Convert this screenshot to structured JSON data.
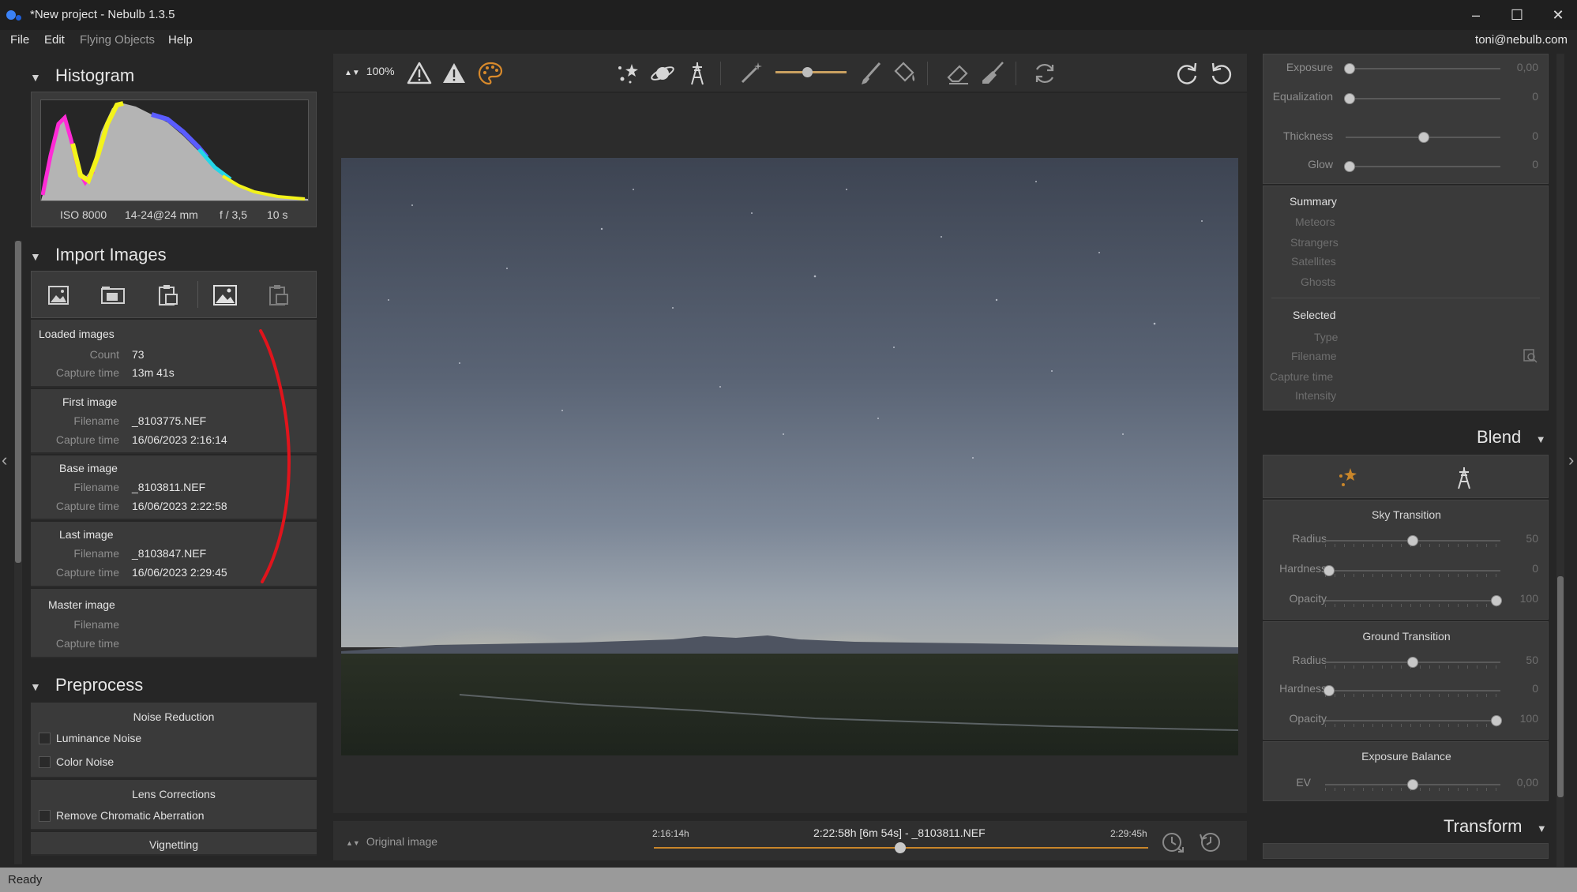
{
  "window": {
    "title": "*New project - Nebulb 1.3.5",
    "controls": [
      "minimize",
      "maximize",
      "close"
    ]
  },
  "menu": {
    "items": [
      "File",
      "Edit",
      "Flying Objects",
      "Help"
    ],
    "user": "toni@nebulb.com"
  },
  "status": "Ready",
  "histogram": {
    "title": "Histogram",
    "iso": "ISO 8000",
    "lens": "14-24@24 mm",
    "aperture": "f / 3,5",
    "exposure": "10 s"
  },
  "import": {
    "title": "Import Images",
    "toolbar_icons": [
      "add-images-icon",
      "add-folder-icon",
      "paste-images-icon",
      "image-icon",
      "clear-images-icon"
    ],
    "loaded": {
      "title": "Loaded images",
      "count_label": "Count",
      "count": "73",
      "capture_label": "Capture time",
      "capture": "13m 41s"
    },
    "first": {
      "title": "First image",
      "filename_label": "Filename",
      "filename": "_8103775.NEF",
      "capture_label": "Capture time",
      "capture": "16/06/2023 2:16:14"
    },
    "base": {
      "title": "Base image",
      "filename_label": "Filename",
      "filename": "_8103811.NEF",
      "capture_label": "Capture time",
      "capture": "16/06/2023 2:22:58"
    },
    "last": {
      "title": "Last image",
      "filename_label": "Filename",
      "filename": "_8103847.NEF",
      "capture_label": "Capture time",
      "capture": "16/06/2023 2:29:45"
    },
    "master": {
      "title": "Master image",
      "filename_label": "Filename",
      "capture_label": "Capture time"
    }
  },
  "preprocess": {
    "title": "Preprocess",
    "noise_title": "Noise Reduction",
    "luminance": "Luminance Noise",
    "color": "Color Noise",
    "lens_title": "Lens Corrections",
    "chromatic": "Remove Chromatic Aberration",
    "vignetting": "Vignetting"
  },
  "toolbar": {
    "zoom": "100%",
    "icons": [
      "warning-outline-icon",
      "warning-filled-icon",
      "palette-icon",
      "stars-icon",
      "planet-icon",
      "tower-icon",
      "magic-wand-icon",
      "brush-icon",
      "fill-bucket-icon",
      "eraser-icon",
      "broom-icon",
      "refresh-icon",
      "redo-icon",
      "undo-icon"
    ],
    "accent": "#c9862a",
    "brush_size_level": 0.5
  },
  "timeline": {
    "view_mode": "Original image",
    "start": "2:16:14h",
    "current": "2:22:58h [6m 54s] - _8103811.NEF",
    "end": "2:29:45h",
    "position": 0.5
  },
  "right": {
    "exposure_label": "Exposure",
    "exposure_val": "0,00",
    "equalization_label": "Equalization",
    "equalization_val": "0",
    "thickness_label": "Thickness",
    "thickness_val": "0",
    "glow_label": "Glow",
    "glow_val": "0",
    "summary": {
      "title": "Summary",
      "items": [
        "Meteors",
        "Strangers",
        "Satellites",
        "Ghosts"
      ]
    },
    "selected": {
      "title": "Selected",
      "items": [
        "Type",
        "Filename",
        "Capture time",
        "Intensity"
      ]
    },
    "blend": {
      "title": "Blend",
      "sky": {
        "title": "Sky Transition",
        "radius_label": "Radius",
        "radius": "50",
        "hardness_label": "Hardness",
        "hardness": "0",
        "opacity_label": "Opacity",
        "opacity": "100"
      },
      "ground": {
        "title": "Ground Transition",
        "radius_label": "Radius",
        "radius": "50",
        "hardness_label": "Hardness",
        "hardness": "0",
        "opacity_label": "Opacity",
        "opacity": "100"
      },
      "exposure": {
        "title": "Exposure Balance",
        "ev_label": "EV",
        "ev": "0,00"
      }
    },
    "transform": "Transform"
  }
}
